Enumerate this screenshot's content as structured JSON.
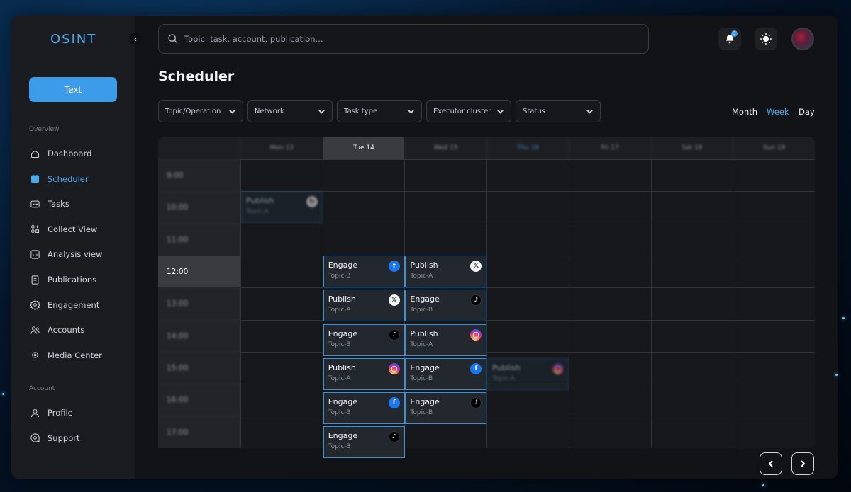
{
  "app": {
    "logo": "OSINT",
    "primary_button": "Text"
  },
  "sidebar": {
    "overview_label": "Overview",
    "overview_items": [
      {
        "label": "Dashboard",
        "icon": "dashboard-icon"
      },
      {
        "label": "Scheduler",
        "icon": "calendar-icon",
        "active": true
      },
      {
        "label": "Tasks",
        "icon": "tasks-icon"
      },
      {
        "label": "Collect View",
        "icon": "collect-icon"
      },
      {
        "label": "Analysis view",
        "icon": "analysis-icon"
      },
      {
        "label": "Publications",
        "icon": "publications-icon"
      },
      {
        "label": "Engagement",
        "icon": "gear-icon"
      },
      {
        "label": "Accounts",
        "icon": "users-icon"
      },
      {
        "label": "Media Center",
        "icon": "target-icon"
      }
    ],
    "account_label": "Account",
    "account_items": [
      {
        "label": "Profile",
        "icon": "user-icon"
      },
      {
        "label": "Support",
        "icon": "support-icon"
      }
    ]
  },
  "header": {
    "search_placeholder": "Topic, task, account, publication...",
    "notification_count": "3",
    "accent": "#3d9ce9"
  },
  "page": {
    "title": "Scheduler",
    "filters": [
      "Topic/Operation",
      "Network",
      "Task type",
      "Executor cluster",
      "Status"
    ],
    "views": [
      "Month",
      "Week",
      "Day"
    ],
    "active_view": "Week"
  },
  "calendar": {
    "days": [
      "Mon 13",
      "Tue 14",
      "Wed 15",
      "Thu 16",
      "Fri 17",
      "Sat 18",
      "Sun 19"
    ],
    "current_day": "Tue 14",
    "times": [
      "9:00",
      "10:00",
      "11:00",
      "12:00",
      "13:00",
      "14:00",
      "15:00",
      "16:00",
      "17:00"
    ],
    "current_time": "12:00",
    "events": [
      {
        "day": 0,
        "hour": 1,
        "title": "Publish",
        "topic": "Topic-A",
        "network": "generic",
        "faded": true
      },
      {
        "day": 1,
        "hour": 3,
        "title": "Engage",
        "topic": "Topic-B",
        "network": "facebook"
      },
      {
        "day": 1,
        "hour": 4,
        "title": "Publish",
        "topic": "Topic-A",
        "network": "x"
      },
      {
        "day": 1,
        "hour": 5,
        "title": "Engage",
        "topic": "Topic-B",
        "network": "tiktok"
      },
      {
        "day": 1,
        "hour": 6,
        "title": "Publish",
        "topic": "Topic-A",
        "network": "instagram"
      },
      {
        "day": 1,
        "hour": 7,
        "title": "Engage",
        "topic": "Topic-B",
        "network": "facebook"
      },
      {
        "day": 1,
        "hour": 8,
        "title": "Engage",
        "topic": "Topic-B",
        "network": "tiktok"
      },
      {
        "day": 2,
        "hour": 3,
        "title": "Publish",
        "topic": "Topic-A",
        "network": "x"
      },
      {
        "day": 2,
        "hour": 4,
        "title": "Engage",
        "topic": "Topic-B",
        "network": "tiktok"
      },
      {
        "day": 2,
        "hour": 5,
        "title": "Publish",
        "topic": "Topic-A",
        "network": "instagram"
      },
      {
        "day": 2,
        "hour": 6,
        "title": "Engage",
        "topic": "Topic-B",
        "network": "facebook"
      },
      {
        "day": 2,
        "hour": 7,
        "title": "Engage",
        "topic": "Topic-B",
        "network": "tiktok"
      },
      {
        "day": 3,
        "hour": 6,
        "title": "Publish",
        "topic": "Topic-A",
        "network": "instagram",
        "faded": true
      }
    ]
  },
  "pager": {
    "prev_icon": "chevron-left-icon",
    "next_icon": "chevron-right-icon"
  }
}
